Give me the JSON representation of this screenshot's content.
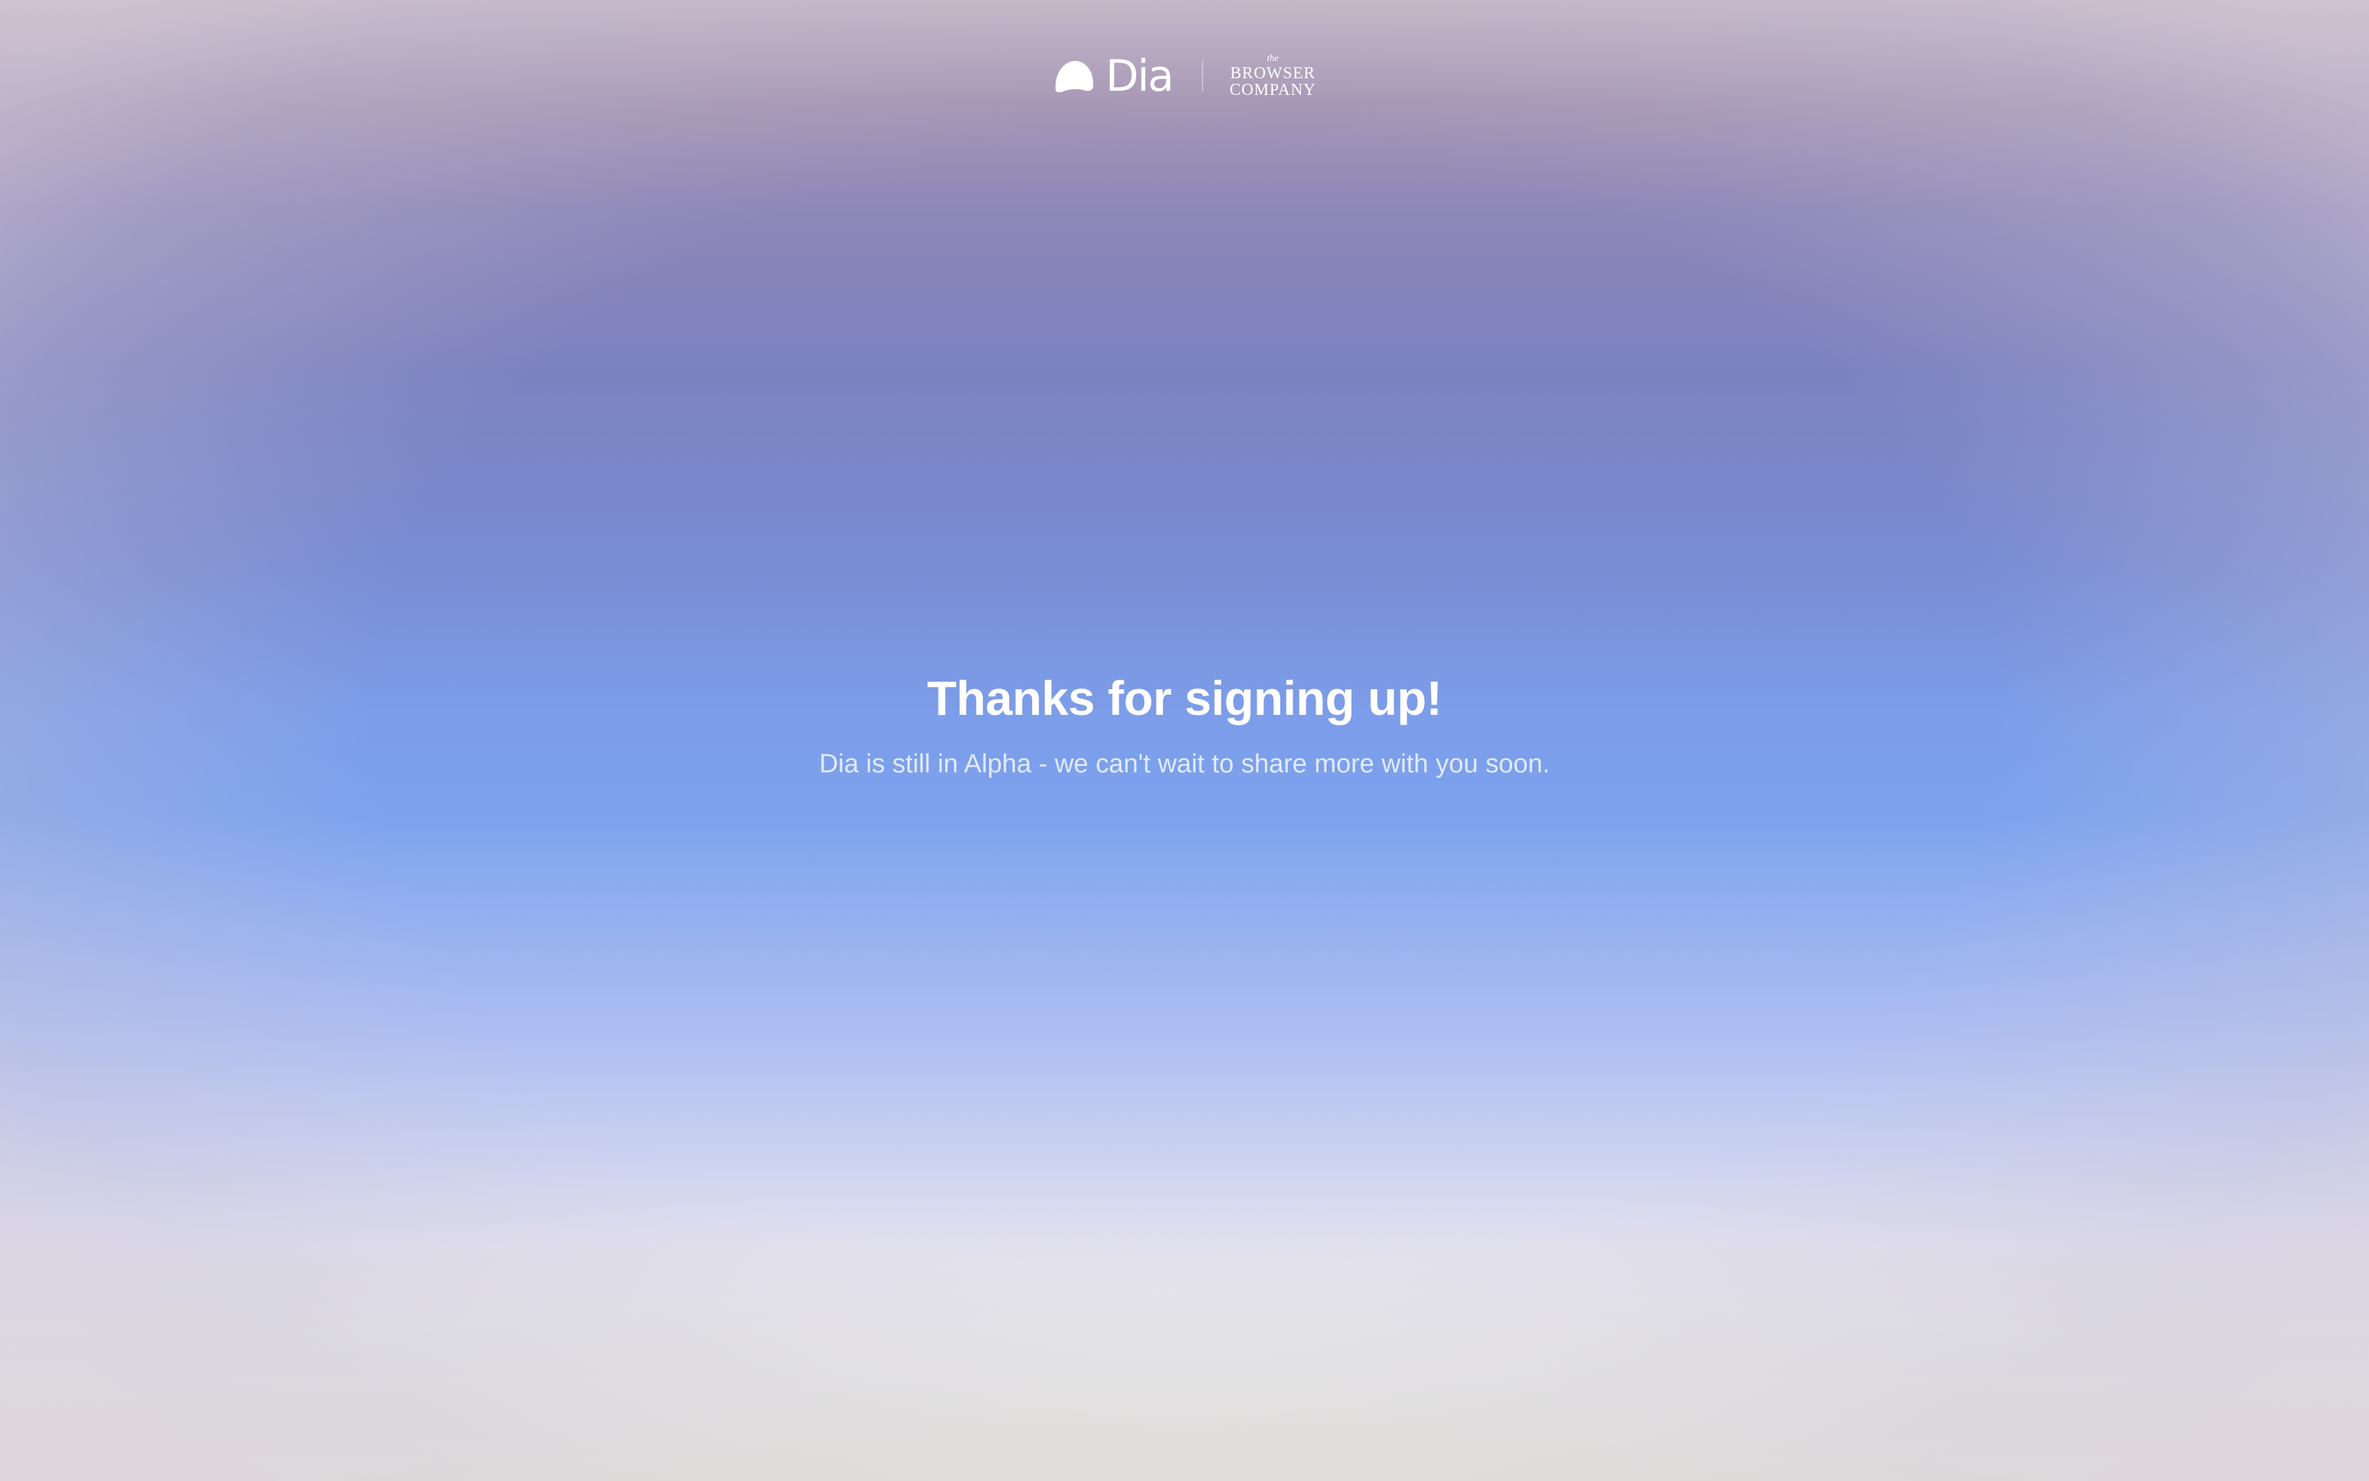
{
  "header": {
    "brand_name": "Dia",
    "partner_logo": {
      "the": "the",
      "line1": "BROWSER",
      "line2": "COMPANY"
    },
    "icons": {
      "dia_logo": "speech-bubble-dome-icon"
    }
  },
  "main": {
    "title": "Thanks for signing up!",
    "subtitle": "Dia is still in Alpha - we can't wait to share more with you soon."
  },
  "colors": {
    "text": "#ffffff",
    "bg_top": "#c4b5c5",
    "bg_mid": "#7ca2ee",
    "bg_bottom": "#e7e6dc"
  }
}
